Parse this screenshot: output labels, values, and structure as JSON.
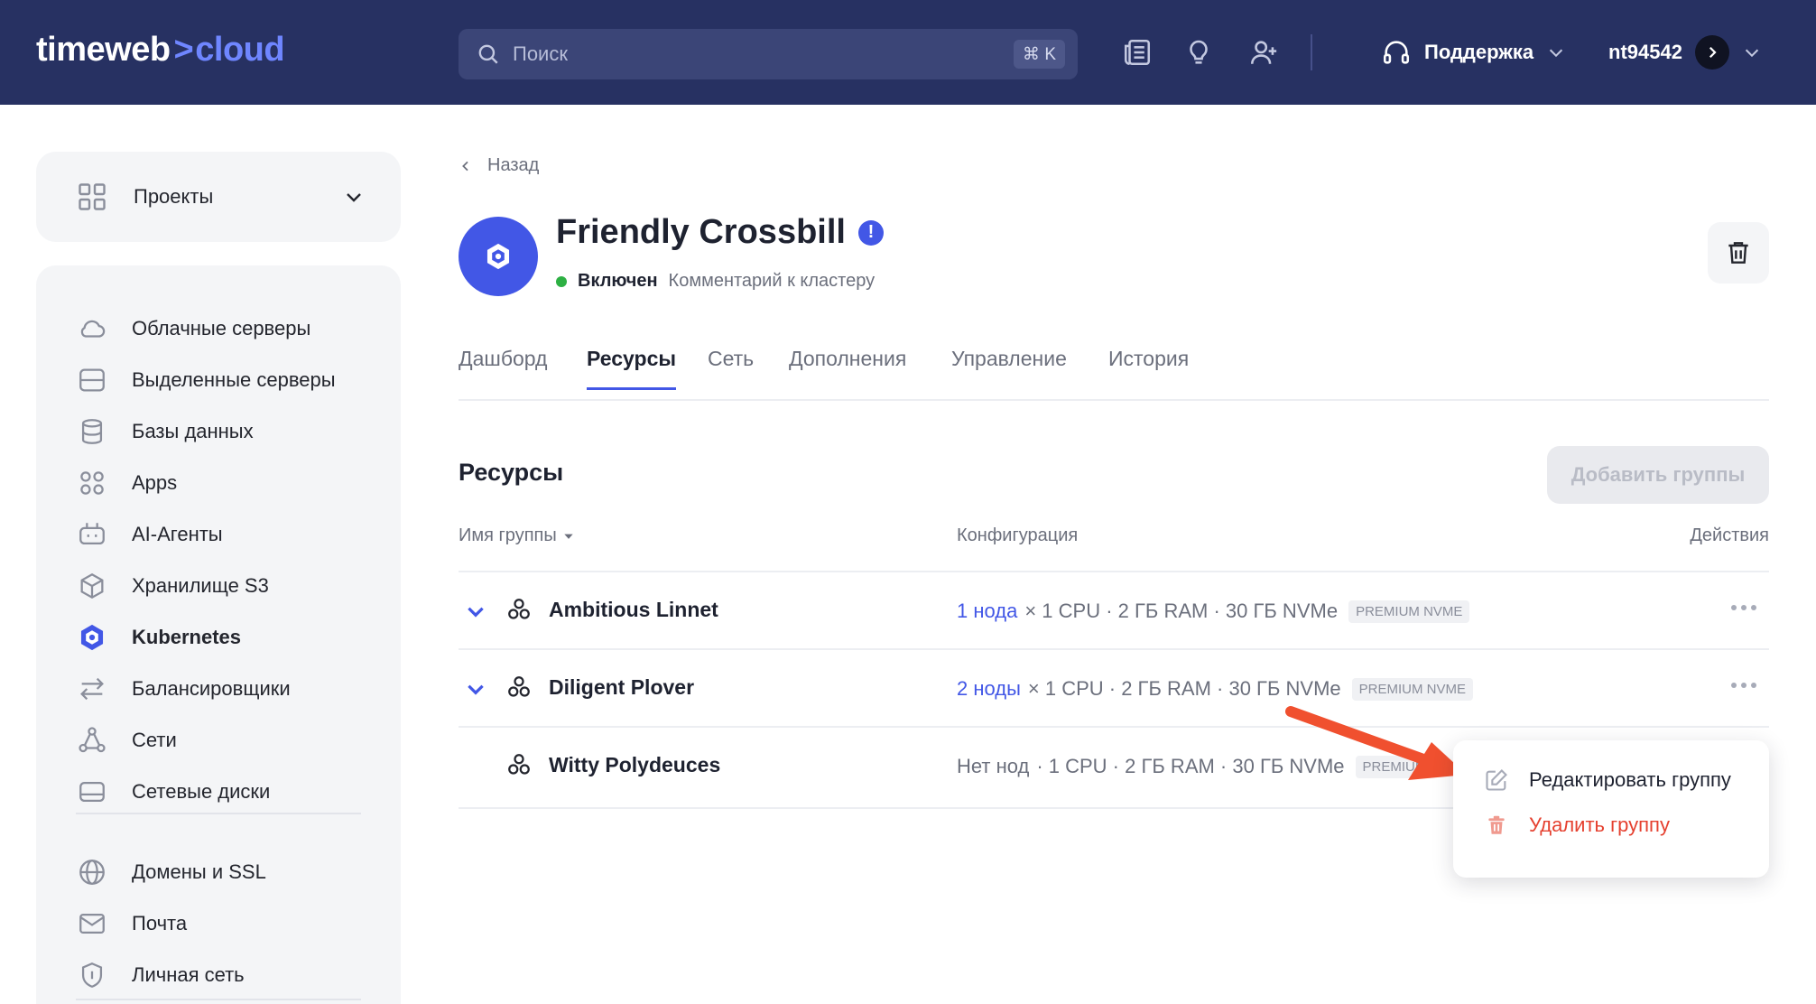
{
  "header": {
    "logo_main": "timeweb",
    "logo_chevron": ">",
    "logo_accent": "cloud",
    "search_placeholder": "Поиск",
    "search_shortcut": "⌘ K",
    "support_label": "Поддержка",
    "account_name": "nt94542",
    "icons": [
      "news-icon",
      "lightbulb-icon",
      "add-user-icon",
      "headset-icon"
    ]
  },
  "sidebar": {
    "projects_label": "Проекты",
    "items": [
      {
        "label": "Облачные серверы",
        "icon": "cloud-icon"
      },
      {
        "label": "Выделенные серверы",
        "icon": "server-icon"
      },
      {
        "label": "Базы данных",
        "icon": "database-icon"
      },
      {
        "label": "Apps",
        "icon": "apps-icon"
      },
      {
        "label": "AI-Агенты",
        "icon": "robot-icon"
      },
      {
        "label": "Хранилище S3",
        "icon": "cube-icon"
      },
      {
        "label": "Kubernetes",
        "icon": "kubernetes-icon",
        "active": true
      },
      {
        "label": "Балансировщики",
        "icon": "swap-arrows-icon"
      },
      {
        "label": "Сети",
        "icon": "network-icon"
      },
      {
        "label": "Сетевые диски",
        "icon": "disk-icon"
      },
      {
        "label": "Домены и SSL",
        "icon": "globe-icon"
      },
      {
        "label": "Почта",
        "icon": "mail-icon"
      },
      {
        "label": "Личная сеть",
        "icon": "shield-icon"
      }
    ]
  },
  "cluster": {
    "back_label": "Назад",
    "name": "Friendly Crossbill",
    "warning_glyph": "!",
    "status": "Включен",
    "comment": "Комментарий к кластеру"
  },
  "tabs": [
    {
      "label": "Дашборд"
    },
    {
      "label": "Ресурсы",
      "active": true
    },
    {
      "label": "Сеть"
    },
    {
      "label": "Дополнения"
    },
    {
      "label": "Управление"
    },
    {
      "label": "История"
    }
  ],
  "resources": {
    "title": "Ресурсы",
    "add_button": "Добавить группы",
    "columns": {
      "name": "Имя группы",
      "config": "Конфигурация",
      "actions": "Действия"
    },
    "rows": [
      {
        "name": "Ambitious Linnet",
        "nodes": "1 нода",
        "spec": "× 1 CPU · 2 ГБ RAM · 30 ГБ NVMe",
        "badge": "PREMIUM NVME",
        "expandable": true
      },
      {
        "name": "Diligent Plover",
        "nodes": "2 ноды",
        "spec": "× 1 CPU · 2 ГБ RAM · 30 ГБ NVMe",
        "badge": "PREMIUM NVME",
        "expandable": true
      },
      {
        "name": "Witty Polydeuces",
        "nodes": "Нет нод",
        "spec": "· 1 CPU · 2 ГБ RAM · 30 ГБ NVMe",
        "badge": "PREMIUM",
        "expandable": false
      }
    ]
  },
  "context_menu": {
    "edit": "Редактировать группу",
    "delete": "Удалить группу"
  },
  "colors": {
    "header_bg": "#273162",
    "accent": "#4257e6",
    "danger": "#e5402f",
    "annotation_arrow": "#f0502f",
    "status_green": "#2db043"
  }
}
